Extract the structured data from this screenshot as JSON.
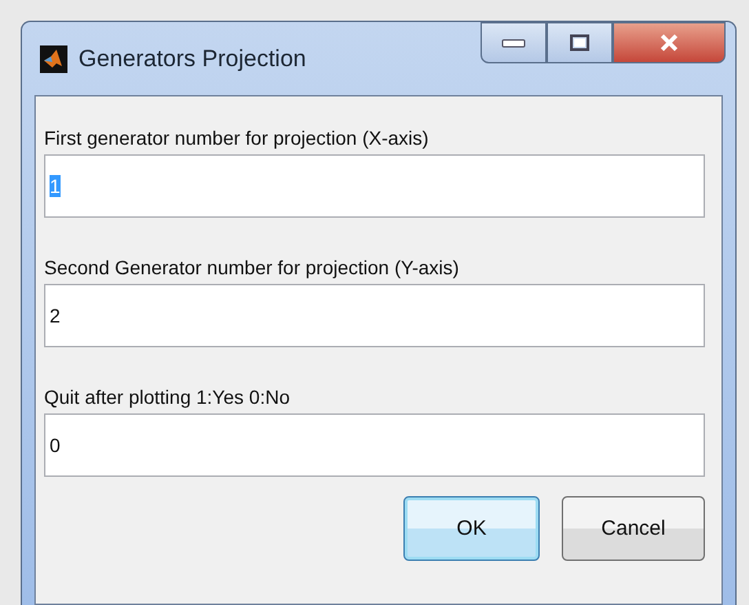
{
  "window": {
    "title": "Generators Projection"
  },
  "fields": [
    {
      "label": "First generator number for projection (X-axis)",
      "value": "1",
      "text_selected": true
    },
    {
      "label": "Second Generator number for projection (Y-axis)",
      "value": "2",
      "text_selected": false
    },
    {
      "label": "Quit after plotting 1:Yes  0:No",
      "value": "0",
      "text_selected": false
    }
  ],
  "buttons": [
    {
      "label": "OK",
      "default": true
    },
    {
      "label": "Cancel",
      "default": false
    }
  ]
}
